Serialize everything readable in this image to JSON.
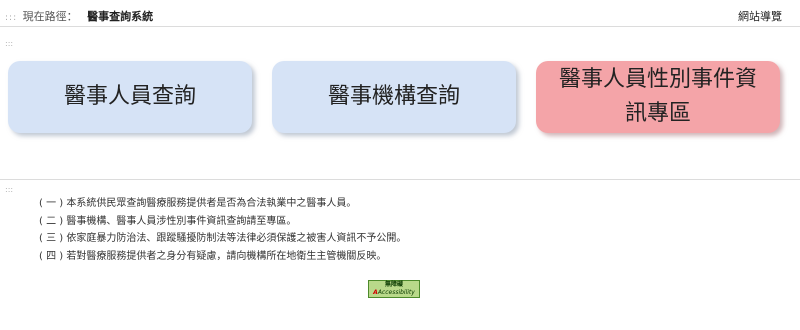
{
  "breadcrumb": {
    "marker": ":::",
    "label": "現在路徑：",
    "current": "醫事查詢系統"
  },
  "header": {
    "sitemap_label": "網站導覽"
  },
  "accesskeys": {
    "content_marker": ":::",
    "footer_marker": ":::"
  },
  "buttons": [
    {
      "label": "醫事人員查詢",
      "color": "#d6e3f6"
    },
    {
      "label": "醫事機構查詢",
      "color": "#d6e3f6"
    },
    {
      "label": "醫事人員性別事件資訊專區",
      "color": "#f4a4a8"
    }
  ],
  "notes": [
    "( 一 ) 本系統供民眾查詢醫療服務提供者是否為合法執業中之醫事人員。",
    "( 二 ) 醫事機構、醫事人員涉性別事件資訊查詢請至專區。",
    "( 三 ) 依家庭暴力防治法、跟蹤騷擾防制法等法律必須保護之被害人資訊不予公開。",
    "( 四 ) 若對醫療服務提供者之身分有疑慮，請向機構所在地衛生主管機關反映。"
  ],
  "accessibility_badge": {
    "top_text": "無障礙",
    "bottom_prefix": "A",
    "bottom_text": "Accessibility",
    "color": "#b9d98a"
  }
}
